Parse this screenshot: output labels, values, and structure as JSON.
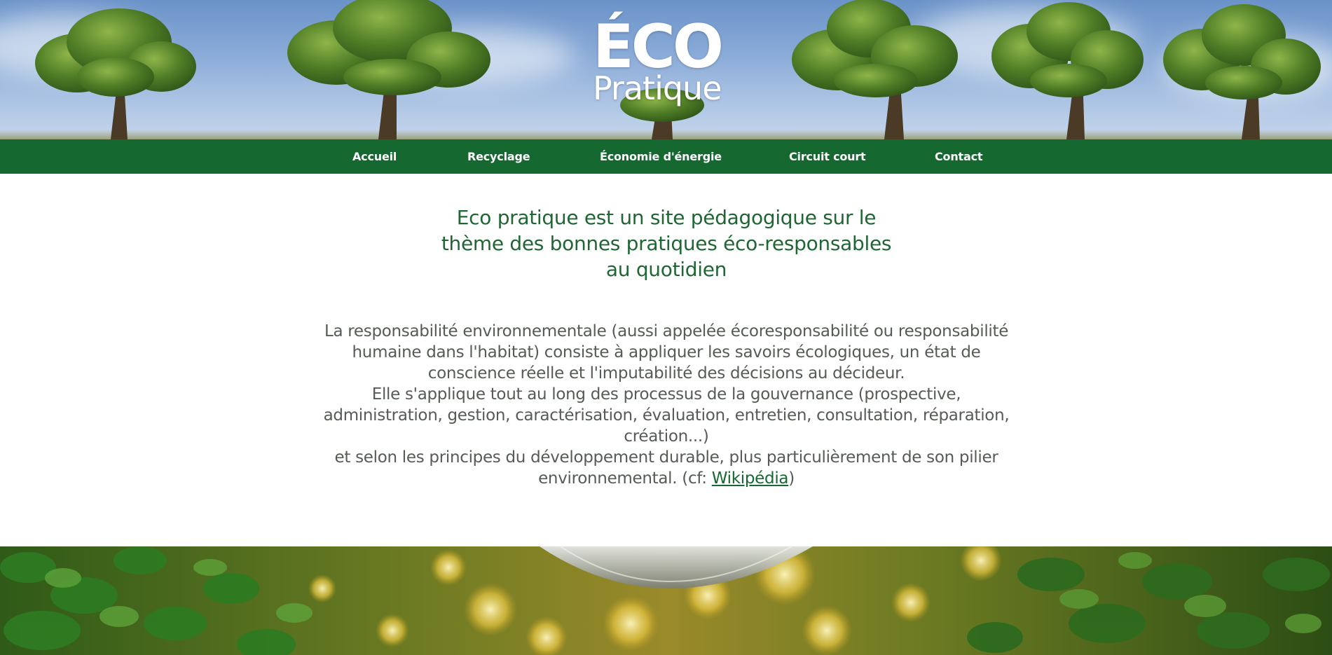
{
  "brand": {
    "logo_main": "ÉCO",
    "logo_sub": "Pratique"
  },
  "nav": {
    "items": [
      {
        "label": "Accueil"
      },
      {
        "label": "Recyclage"
      },
      {
        "label": "Économie d'énergie"
      },
      {
        "label": "Circuit court"
      },
      {
        "label": "Contact"
      }
    ]
  },
  "main": {
    "intro": "Eco pratique est un site pédagogique sur le thème des bonnes pratiques éco-responsables au quotidien",
    "para_1": "La responsabilité environnementale (aussi appelée écoresponsabilité ou responsabilité humaine dans l'habitat) consiste à appliquer les savoirs écologiques, un état de conscience réelle et l'imputabilité des décisions au décideur.",
    "para_2": "Elle s'applique tout au long des processus de la gouvernance (prospective, administration, gestion, caractérisation, évaluation, entretien, consultation, réparation, création...)",
    "para_3_prefix": "et selon les principes du développement durable, plus particulièrement de son pilier environnemental. (cf: ",
    "link_label": "Wikipédia",
    "para_3_suffix": ")"
  },
  "colors": {
    "nav_bg": "#156930",
    "intro_text": "#1f6634",
    "body_text": "#555b55",
    "link": "#156930"
  },
  "icons": {
    "hero_image": "trees-sky-photo",
    "bottom_image": "globe-leaves-bokeh-photo"
  }
}
